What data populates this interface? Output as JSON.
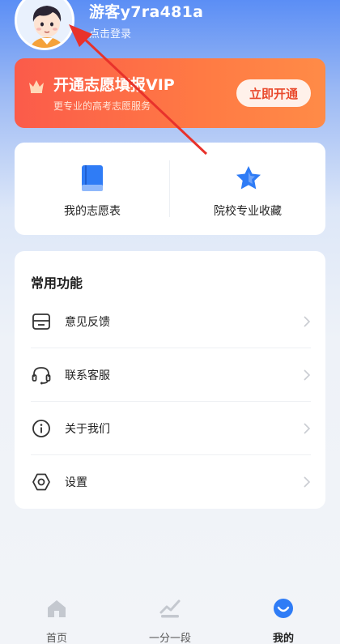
{
  "profile": {
    "username": "游客y7ra481a",
    "login_label": "点击登录"
  },
  "vip": {
    "title": "开通志愿填报VIP",
    "subtitle": "更专业的高考志愿服务",
    "button_label": "立即开通"
  },
  "quick": {
    "items": [
      {
        "label": "我的志愿表",
        "icon": "book-icon"
      },
      {
        "label": "院校专业收藏",
        "icon": "star-icon"
      }
    ]
  },
  "functions": {
    "title": "常用功能",
    "items": [
      {
        "label": "意见反馈",
        "icon": "feedback-icon"
      },
      {
        "label": "联系客服",
        "icon": "headset-icon"
      },
      {
        "label": "关于我们",
        "icon": "info-icon"
      },
      {
        "label": "设置",
        "icon": "settings-icon"
      }
    ]
  },
  "tabbar": {
    "tabs": [
      {
        "label": "首页",
        "icon": "home-icon",
        "active": false
      },
      {
        "label": "一分一段",
        "icon": "chart-icon",
        "active": false
      },
      {
        "label": "我的",
        "icon": "profile-icon",
        "active": true
      }
    ]
  },
  "colors": {
    "header_blue": "#5b8ef5",
    "vip_orange": "#fb5b4a",
    "primary_blue": "#2f7cf6",
    "annotation_red": "#e8322b"
  }
}
